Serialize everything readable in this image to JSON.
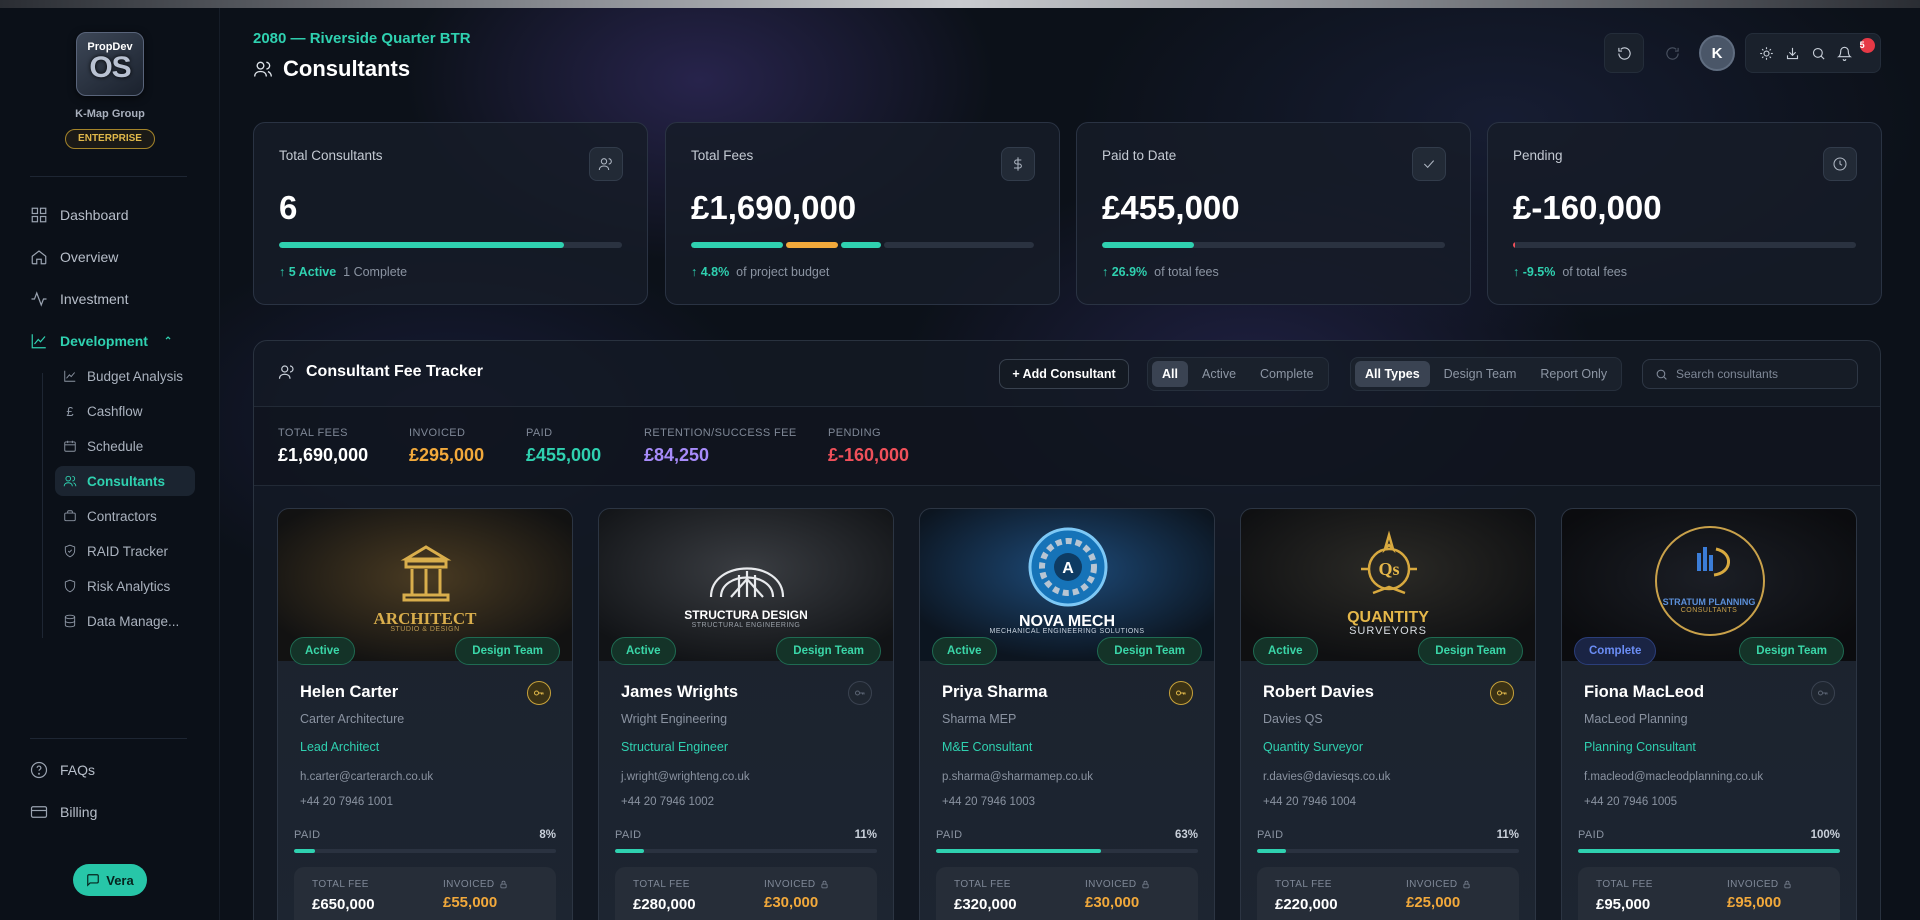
{
  "app": {
    "logo_top": "PropDev",
    "logo_main": "OS",
    "org": "K-Map Group",
    "tier": "ENTERPRISE"
  },
  "nav": {
    "main": [
      {
        "label": "Dashboard",
        "icon": "grid-icon"
      },
      {
        "label": "Overview",
        "icon": "home-icon"
      },
      {
        "label": "Investment",
        "icon": "activity-icon"
      },
      {
        "label": "Development",
        "icon": "chart-line-icon",
        "active": true
      }
    ],
    "sub": [
      {
        "label": "Budget Analysis",
        "icon": "chart-icon"
      },
      {
        "label": "Cashflow",
        "icon": "pound-icon"
      },
      {
        "label": "Schedule",
        "icon": "calendar-icon"
      },
      {
        "label": "Consultants",
        "icon": "users-icon",
        "active": true
      },
      {
        "label": "Contractors",
        "icon": "briefcase-icon"
      },
      {
        "label": "RAID Tracker",
        "icon": "shield-icon"
      },
      {
        "label": "Risk Analytics",
        "icon": "shield-icon"
      },
      {
        "label": "Data Manage...",
        "icon": "database-icon"
      }
    ],
    "bottom": [
      {
        "label": "FAQs",
        "icon": "help-icon"
      },
      {
        "label": "Billing",
        "icon": "card-icon"
      }
    ],
    "vera": "Vera"
  },
  "header": {
    "project": "2080 — Riverside Quarter BTR",
    "title": "Consultants",
    "avatar": "K",
    "notifications": "5"
  },
  "kpis": [
    {
      "label": "Total Consultants",
      "value": "6",
      "foot_up": "↑ 5 Active",
      "foot_rest": "1 Complete",
      "icon": "users-icon",
      "progress": 0.83
    },
    {
      "label": "Total Fees",
      "value": "£1,690,000",
      "foot_up": "↑ 4.8%",
      "foot_rest": "of project budget",
      "icon": "dollar-icon"
    },
    {
      "label": "Paid to Date",
      "value": "£455,000",
      "foot_up": "↑ 26.9%",
      "foot_rest": "of total fees",
      "icon": "check-icon",
      "progress": 0.269
    },
    {
      "label": "Pending",
      "value": "£-160,000",
      "foot_up": "↑ -9.5%",
      "foot_rest": "of total fees",
      "icon": "clock-icon",
      "progress": 0.0
    }
  ],
  "tracker": {
    "title": "Consultant Fee Tracker",
    "add_label": "+ Add Consultant",
    "status_filters": [
      "All",
      "Active",
      "Complete"
    ],
    "type_filters": [
      "All Types",
      "Design Team",
      "Report Only"
    ],
    "search_placeholder": "Search consultants",
    "summary": [
      {
        "label": "TOTAL FEES",
        "value": "£1,690,000",
        "color": "#ffffff"
      },
      {
        "label": "INVOICED",
        "value": "£295,000",
        "color": "#f2a93b"
      },
      {
        "label": "PAID",
        "value": "£455,000",
        "color": "#2fd1b0"
      },
      {
        "label": "RETENTION/SUCCESS FEE",
        "value": "£84,250",
        "color": "#a78bfa"
      },
      {
        "label": "PENDING",
        "value": "£-160,000",
        "color": "#f0505a"
      }
    ]
  },
  "cards": [
    {
      "status": "Active",
      "type": "Design Team",
      "name": "Helen Carter",
      "company": "Carter Architecture",
      "role": "Lead Architect",
      "email": "h.carter@carterarch.co.uk",
      "phone": "+44 20 7946 1001",
      "paid_label": "PAID",
      "paid_pct": "8%",
      "paid_fraction": 0.08,
      "total_fee_label": "TOTAL FEE",
      "total_fee": "£650,000",
      "invoiced_label": "INVOICED",
      "invoiced": "£55,000",
      "logo_main": "ARCHITECT",
      "logo_sub": "STUDIO & DESIGN",
      "key_active": true
    },
    {
      "status": "Active",
      "type": "Design Team",
      "name": "James Wrights",
      "company": "Wright Engineering",
      "role": "Structural Engineer",
      "email": "j.wright@wrighteng.co.uk",
      "phone": "+44 20 7946 1002",
      "paid_label": "PAID",
      "paid_pct": "11%",
      "paid_fraction": 0.11,
      "total_fee_label": "TOTAL FEE",
      "total_fee": "£280,000",
      "invoiced_label": "INVOICED",
      "invoiced": "£30,000",
      "logo_main": "STRUCTURA DESIGN",
      "logo_sub": "STRUCTURAL ENGINEERING",
      "key_active": false
    },
    {
      "status": "Active",
      "type": "Design Team",
      "name": "Priya Sharma",
      "company": "Sharma MEP",
      "role": "M&E Consultant",
      "email": "p.sharma@sharmamep.co.uk",
      "phone": "+44 20 7946 1003",
      "paid_label": "PAID",
      "paid_pct": "63%",
      "paid_fraction": 0.63,
      "total_fee_label": "TOTAL FEE",
      "total_fee": "£320,000",
      "invoiced_label": "INVOICED",
      "invoiced": "£30,000",
      "logo_main": "NOVA MECH",
      "logo_sub": "MECHANICAL ENGINEERING SOLUTIONS",
      "key_active": true
    },
    {
      "status": "Active",
      "type": "Design Team",
      "name": "Robert Davies",
      "company": "Davies QS",
      "role": "Quantity Surveyor",
      "email": "r.davies@daviesqs.co.uk",
      "phone": "+44 20 7946 1004",
      "paid_label": "PAID",
      "paid_pct": "11%",
      "paid_fraction": 0.11,
      "total_fee_label": "TOTAL FEE",
      "total_fee": "£220,000",
      "invoiced_label": "INVOICED",
      "invoiced": "£25,000",
      "logo_main": "QUANTITY",
      "logo_sub": "SURVEYORS",
      "key_active": true
    },
    {
      "status": "Complete",
      "type": "Design Team",
      "name": "Fiona MacLeod",
      "company": "MacLeod Planning",
      "role": "Planning Consultant",
      "email": "f.macleod@macleodplanning.co.uk",
      "phone": "+44 20 7946 1005",
      "paid_label": "PAID",
      "paid_pct": "100%",
      "paid_fraction": 1.0,
      "total_fee_label": "TOTAL FEE",
      "total_fee": "£95,000",
      "invoiced_label": "INVOICED",
      "invoiced": "£95,000",
      "logo_main": "STRATUM PLANNING",
      "logo_sub": "CONSULTANTS",
      "key_active": false
    }
  ]
}
